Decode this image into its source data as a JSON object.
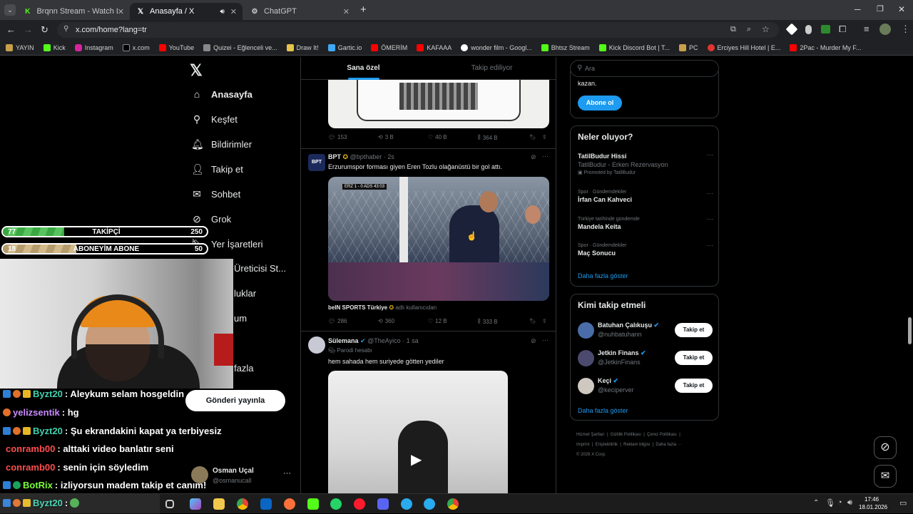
{
  "browser": {
    "tabs": [
      {
        "title": "Brqnn Stream - Watch Live on K",
        "icon": "kick-icon",
        "active": false
      },
      {
        "title": "Anasayfa / X",
        "icon": "x-icon",
        "active": true
      },
      {
        "title": "ChatGPT",
        "icon": "chatgpt-icon",
        "active": false
      }
    ],
    "new_tab": "+",
    "url": "x.com/home?lang=tr",
    "bookmarks": [
      "YAYIN",
      "Kick",
      "Instagram",
      "x.com",
      "YouTube",
      "Quizei - Eğlenceli ve...",
      "Draw It!",
      "Gartic.io",
      "ÖMERİM",
      "KAFAAA",
      "wonder film - Googl...",
      "Bhtsz Stream",
      "Kick Discord Bot | T...",
      "PC",
      "Erciyes Hill Hotel | E...",
      "2Pac - Murder My F..."
    ]
  },
  "nav": {
    "items": [
      "Anasayfa",
      "Keşfet",
      "Bildirimler",
      "Takip et",
      "Sohbet",
      "Grok",
      "Yer İşaretleri",
      "Üreticisi St...",
      "luklar",
      "um",
      "fazla"
    ],
    "post_button": "Gönderi yayınla",
    "account_name": "Osman Uçal",
    "account_handle": "@osmanucall"
  },
  "feed": {
    "tabs": [
      "Sana özel",
      "Takip ediliyor"
    ],
    "post1_stats": {
      "replies": "153",
      "reposts": "3 B",
      "likes": "40 B",
      "views": "364 B"
    },
    "post2": {
      "name": "BPT",
      "handle": "@bpthaber",
      "time": "· 2s",
      "text": "Erzurumspor forması giyen Eren Tozlu olağanüstü bir gol attı.",
      "scoreboard": "ERZ 1 - 0 ADS 43:03",
      "source_name": "beIN SPORTS Türkiye",
      "source_note": "adlı kullanıcıdan",
      "stats": {
        "replies": "286",
        "reposts": "360",
        "likes": "12 B",
        "views": "333 B"
      }
    },
    "post3": {
      "name": "Sülemana",
      "handle": "@TheAyico",
      "time": "· 1 sa",
      "label": "Parodi hesabı",
      "text": "hem sahada hem suriyede götten yediler"
    }
  },
  "right": {
    "search_placeholder": "Ara",
    "premium_text": "kazan.",
    "subscribe": "Abone ol",
    "trends_title": "Neler oluyor?",
    "trends": [
      {
        "meta": "",
        "name": "TatilBudur Hissi",
        "sub": "TatilBudur - Erken Rezervasyon",
        "promo": "Promoted by TatilBudur"
      },
      {
        "meta": "Spor · Gündemdekiler",
        "name": "İrfan Can Kahveci",
        "sub": "",
        "promo": ""
      },
      {
        "meta": "Türkiye tarihinde gündemde",
        "name": "Mandela Keita",
        "sub": "",
        "promo": ""
      },
      {
        "meta": "Spor · Gündemdekiler",
        "name": "Maç Sonucu",
        "sub": "",
        "promo": ""
      }
    ],
    "show_more": "Daha fazla göster",
    "who_title": "Kimi takip etmeli",
    "who": [
      {
        "name": "Batuhan Çalıkuşu",
        "handle": "@nuhbatuhann"
      },
      {
        "name": "Jetkin Finans",
        "handle": "@JetkinFinans"
      },
      {
        "name": "Keçi",
        "handle": "@keciperver"
      }
    ],
    "follow": "Takip et",
    "footer1": [
      "Hizmet Şartları",
      "Gizlilik Politikası",
      "Çerez Politikası"
    ],
    "footer2": [
      "Imprint",
      "Erişilebilirlik",
      "Reklam bilgisi",
      "Daha fazla ···"
    ],
    "copyright": "© 2026 X Corp."
  },
  "overlay": {
    "followers": {
      "current": "77",
      "label": "TAKİPÇİ",
      "goal": "250",
      "progress": 0.3
    },
    "subs": {
      "current": "18",
      "label": "ABONEYİM ABONE",
      "goal": "50",
      "progress": 0.36
    },
    "chat": [
      {
        "user": "Byzt20",
        "msg": ": Aleykum selam hosgeldin",
        "color": "#3fd2b0"
      },
      {
        "user": "yelizsentik",
        "msg": ": hg",
        "color": "#c98bff"
      },
      {
        "user": "Byzt20",
        "msg": ": Şu ekrandakini kapat ya terbiyesiz",
        "color": "#3fd2b0"
      },
      {
        "user": "conramb00",
        "msg": ": alttaki video banlatır seni",
        "color": "#ff4d4d"
      },
      {
        "user": "conramb00",
        "msg": ": senin için söyledim",
        "color": "#ff4d4d"
      },
      {
        "user": "BotRix",
        "msg": ": izliyorsun madem takip et canım!",
        "color": "#7cfc3a"
      },
      {
        "user": "Byzt20",
        "msg": ":",
        "color": "#3fd2b0"
      }
    ]
  },
  "taskbar": {
    "time": "17:46",
    "date": "18.01.2026"
  }
}
